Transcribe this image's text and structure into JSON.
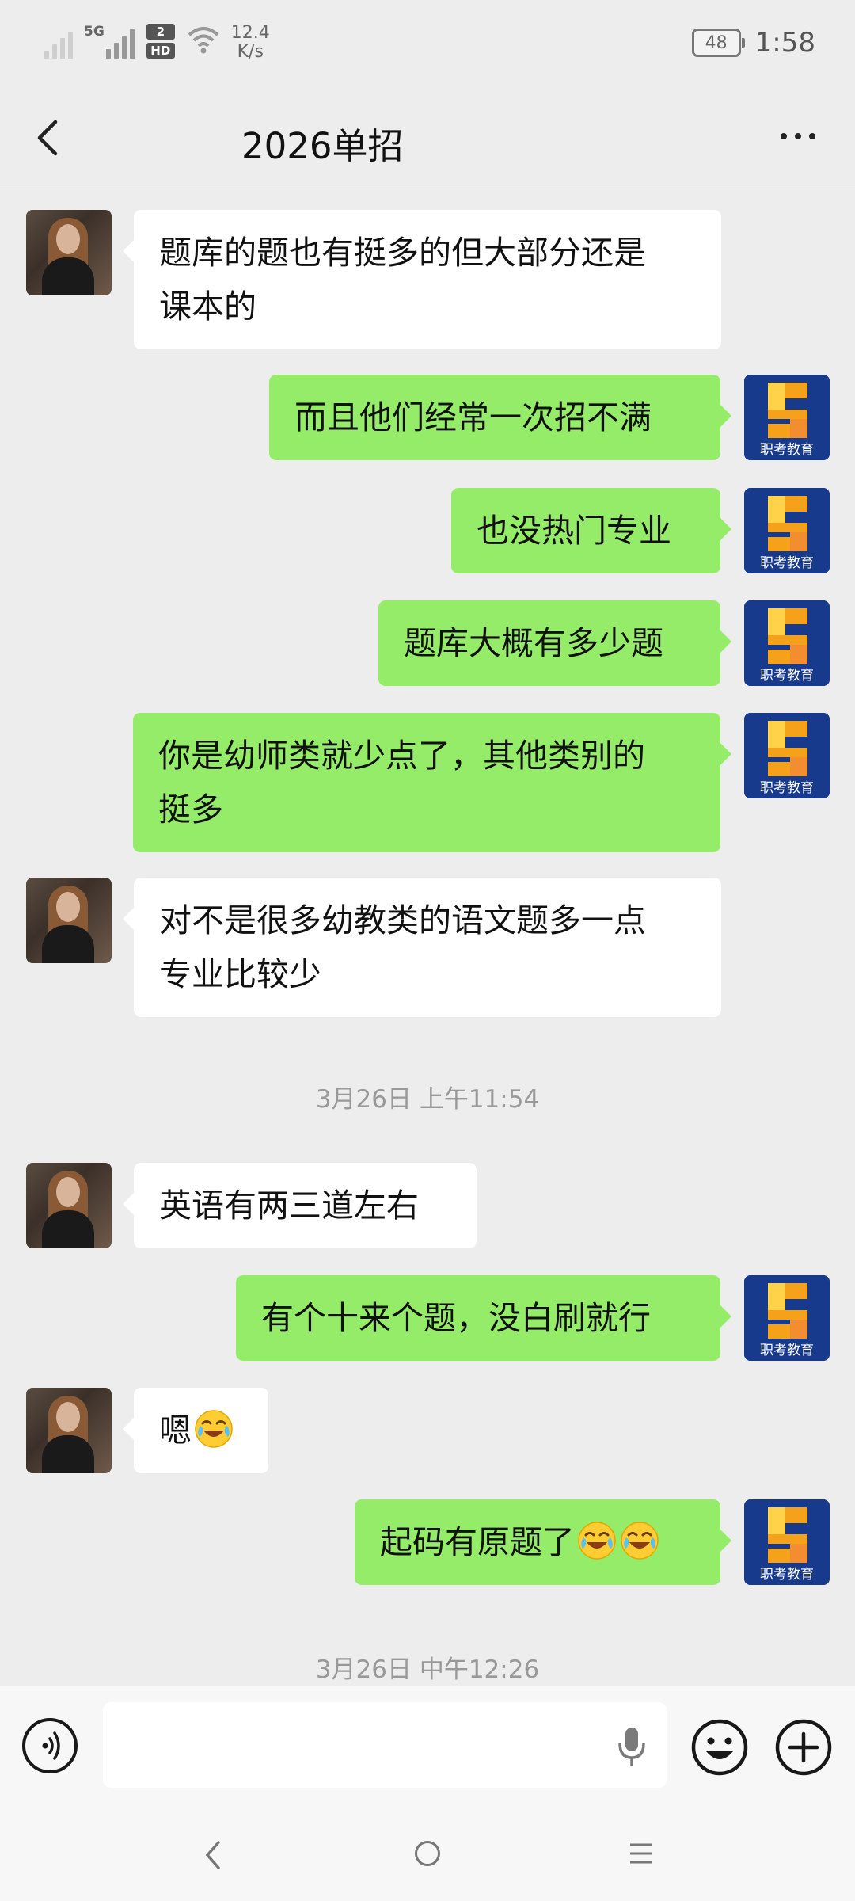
{
  "status_bar": {
    "net_type": "5G",
    "sim2_badge": "2",
    "hd_badge": "HD",
    "speed_value": "12.4",
    "speed_unit": "K/s",
    "battery": "48",
    "time": "1:58"
  },
  "header": {
    "title": "2026单招"
  },
  "messages": [
    {
      "side": "left",
      "lines": [
        "题库的题也有挺多的但大部分还是",
        "课本的"
      ]
    },
    {
      "side": "right",
      "lines": [
        "而且他们经常一次招不满"
      ]
    },
    {
      "side": "right",
      "lines": [
        "也没热门专业"
      ]
    },
    {
      "side": "right",
      "lines": [
        "题库大概有多少题"
      ]
    },
    {
      "side": "right",
      "lines": [
        "你是幼师类就少点了，其他类别的",
        "挺多"
      ]
    },
    {
      "side": "left",
      "lines": [
        "对不是很多幼教类的语文题多一点",
        "专业比较少"
      ]
    },
    {
      "timestamp": "3月26日 上午11:54"
    },
    {
      "side": "left",
      "lines": [
        "英语有两三道左右"
      ]
    },
    {
      "side": "right",
      "lines": [
        "有个十来个题，没白刷就行"
      ]
    },
    {
      "side": "left",
      "text": "嗯",
      "emojis": 1
    },
    {
      "side": "right",
      "text": "起码有原题了",
      "emojis": 2
    },
    {
      "timestamp": "3月26日 中午12:26"
    }
  ],
  "avatar_logo_text": "职考教育",
  "input": {
    "placeholder": ""
  },
  "icons": [
    "back-arrow-icon",
    "more-dots-icon",
    "voice-icon",
    "microphone-icon",
    "emoji-icon",
    "plus-icon",
    "nav-back-icon",
    "nav-home-icon",
    "nav-menu-icon"
  ]
}
